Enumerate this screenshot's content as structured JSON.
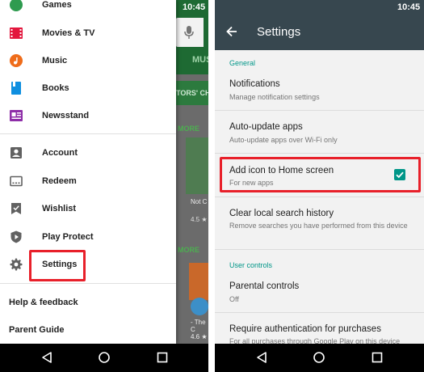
{
  "left": {
    "status_time": "10:45",
    "background": {
      "tab_partial": "MUS",
      "strip_partial": "TORS' CH",
      "more_1": "MORE",
      "more_2": "MORE",
      "card_title_1": "Not C",
      "card_rating_1": "4.5 ★",
      "card_title_2a": "- The",
      "card_title_2b": "C",
      "card_rating_2": "4.6 ★"
    },
    "drawer": {
      "items": [
        {
          "label": "Games",
          "icon": "games-icon"
        },
        {
          "label": "Movies & TV",
          "icon": "movies-tv-icon"
        },
        {
          "label": "Music",
          "icon": "music-icon"
        },
        {
          "label": "Books",
          "icon": "books-icon"
        },
        {
          "label": "Newsstand",
          "icon": "newsstand-icon"
        },
        {
          "label": "Account",
          "icon": "account-icon"
        },
        {
          "label": "Redeem",
          "icon": "redeem-icon"
        },
        {
          "label": "Wishlist",
          "icon": "wishlist-icon"
        },
        {
          "label": "Play Protect",
          "icon": "play-protect-icon"
        },
        {
          "label": "Settings",
          "icon": "gear-icon"
        }
      ],
      "footer": [
        "Help & feedback",
        "Parent Guide"
      ]
    }
  },
  "right": {
    "status_time": "10:45",
    "title": "Settings",
    "sections": {
      "general": "General",
      "user_controls": "User controls"
    },
    "settings": [
      {
        "title": "Notifications",
        "subtitle": "Manage notification settings"
      },
      {
        "title": "Auto-update apps",
        "subtitle": "Auto-update apps over Wi-Fi only"
      },
      {
        "title": "Add icon to Home screen",
        "subtitle": "For new apps",
        "checked": true
      },
      {
        "title": "Clear local search history",
        "subtitle": "Remove searches you have performed from this device"
      },
      {
        "title": "Parental controls",
        "subtitle": "Off"
      },
      {
        "title": "Require authentication for purchases",
        "subtitle": "For all purchases through Google Play on this device"
      }
    ]
  },
  "colors": {
    "highlight": "#e8202a",
    "accent_teal": "#009688",
    "appbar": "#37474f"
  }
}
